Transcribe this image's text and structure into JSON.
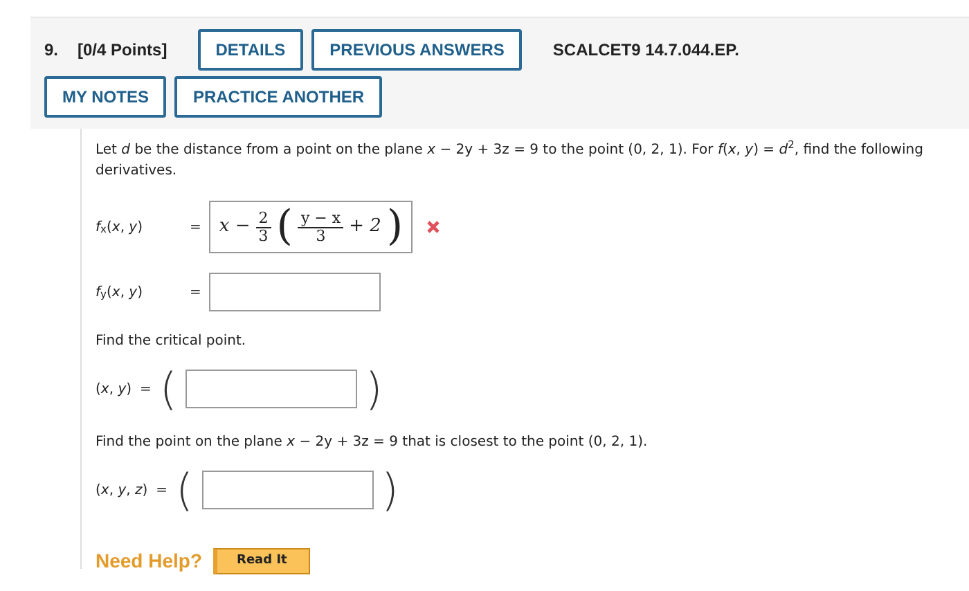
{
  "header": {
    "number": "9.",
    "points": "[0/4 Points]",
    "reference": "SCALCET9 14.7.044.EP.",
    "row1_buttons": [
      "DETAILS",
      "PREVIOUS ANSWERS"
    ],
    "row2_buttons": [
      "MY NOTES",
      "PRACTICE ANOTHER"
    ]
  },
  "question": {
    "intro": "Let *d* be the distance from a point on the plane *x* − 2y + 3z = 9 to the point (0, 2, 1). For *f*(*x*, *y*) = *d*$^{2}$, find the following derivatives.",
    "parts": [
      {
        "kind": "answer",
        "label": "*f*$_{x}$(*x*, *y*)",
        "equals": "=",
        "correct": false,
        "value": [
          {
            "kind": "text",
            "text": "x −"
          },
          {
            "kind": "frac",
            "num": "2",
            "den": "3"
          },
          {
            "kind": "paren",
            "text": "("
          },
          {
            "kind": "frac",
            "num": "y − x",
            "den": "3"
          },
          {
            "kind": "text",
            "text": "+ 2"
          },
          {
            "kind": "paren",
            "text": ")"
          }
        ]
      },
      {
        "kind": "answer",
        "label": "*f*$_{y}$(*x*, *y*)",
        "equals": "="
      },
      {
        "kind": "prompt",
        "text": "Find the critical point."
      },
      {
        "kind": "answer",
        "label": "(*x*, *y*)",
        "equals": "=",
        "open": "(",
        "close": ")"
      },
      {
        "kind": "prompt",
        "text": "Find the point on the plane *x* − 2y + 3z = 9 that is closest to the point (0, 2, 1)."
      },
      {
        "kind": "answer",
        "label": "(*x*, *y*, *z*)",
        "equals": "=",
        "open": "(",
        "close": ")"
      }
    ]
  },
  "help": {
    "label": "Need Help?",
    "buttons": [
      "Read It"
    ]
  }
}
